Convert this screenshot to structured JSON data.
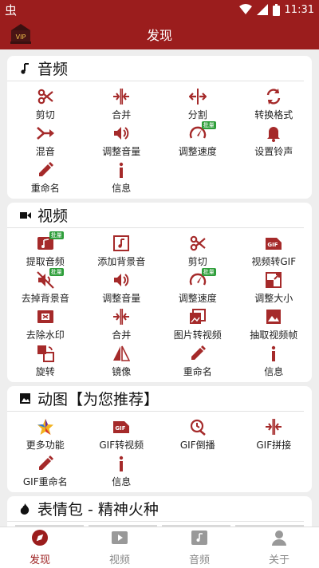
{
  "status": {
    "time": "11:31",
    "left_glyph": "虫"
  },
  "appbar": {
    "title": "发现",
    "logo_text": "VIP"
  },
  "sections": [
    {
      "title": "音频",
      "items": [
        {
          "label": "剪切",
          "icon": "scissors-icon"
        },
        {
          "label": "合并",
          "icon": "merge-icon"
        },
        {
          "label": "分割",
          "icon": "split-icon"
        },
        {
          "label": "转换格式",
          "icon": "convert-icon"
        },
        {
          "label": "混音",
          "icon": "mix-icon"
        },
        {
          "label": "调整音量",
          "icon": "volume-icon"
        },
        {
          "label": "调整速度",
          "icon": "speed-icon",
          "badge": "批量"
        },
        {
          "label": "设置铃声",
          "icon": "bell-icon"
        },
        {
          "label": "重命名",
          "icon": "pencil-icon"
        },
        {
          "label": "信息",
          "icon": "info-icon"
        }
      ]
    },
    {
      "title": "视频",
      "items": [
        {
          "label": "提取音频",
          "icon": "extract-audio-icon",
          "badge": "批量"
        },
        {
          "label": "添加背景音",
          "icon": "music-note-icon"
        },
        {
          "label": "剪切",
          "icon": "scissors-icon"
        },
        {
          "label": "视频转GIF",
          "icon": "gif-icon"
        },
        {
          "label": "去掉背景音",
          "icon": "mute-icon",
          "badge": "批量"
        },
        {
          "label": "调整音量",
          "icon": "volume-icon"
        },
        {
          "label": "调整速度",
          "icon": "speed-icon",
          "badge": "批量"
        },
        {
          "label": "调整大小",
          "icon": "resize-icon"
        },
        {
          "label": "去除水印",
          "icon": "watermark-icon"
        },
        {
          "label": "合并",
          "icon": "merge-icon"
        },
        {
          "label": "图片转视频",
          "icon": "photos-icon"
        },
        {
          "label": "抽取视频帧",
          "icon": "image-icon"
        },
        {
          "label": "旋转",
          "icon": "rotate-icon"
        },
        {
          "label": "镜像",
          "icon": "mirror-icon"
        },
        {
          "label": "重命名",
          "icon": "pencil-icon"
        },
        {
          "label": "信息",
          "icon": "info-icon"
        }
      ]
    },
    {
      "title": "动图【为您推荐】",
      "items": [
        {
          "label": "更多功能",
          "icon": "star-icon"
        },
        {
          "label": "GIF转视频",
          "icon": "gif-icon"
        },
        {
          "label": "GIF倒播",
          "icon": "reverse-icon"
        },
        {
          "label": "GIF拼接",
          "icon": "merge-icon"
        },
        {
          "label": "GIF重命名",
          "icon": "pencil-icon"
        },
        {
          "label": "信息",
          "icon": "info-icon"
        }
      ]
    },
    {
      "title": "表情包 - 精神火种",
      "items": []
    }
  ],
  "bottom_nav": [
    {
      "label": "发现",
      "icon": "compass-icon",
      "active": true
    },
    {
      "label": "视频",
      "icon": "video-icon",
      "active": false
    },
    {
      "label": "音频",
      "icon": "audio-icon",
      "active": false
    },
    {
      "label": "关于",
      "icon": "person-icon",
      "active": false
    }
  ]
}
